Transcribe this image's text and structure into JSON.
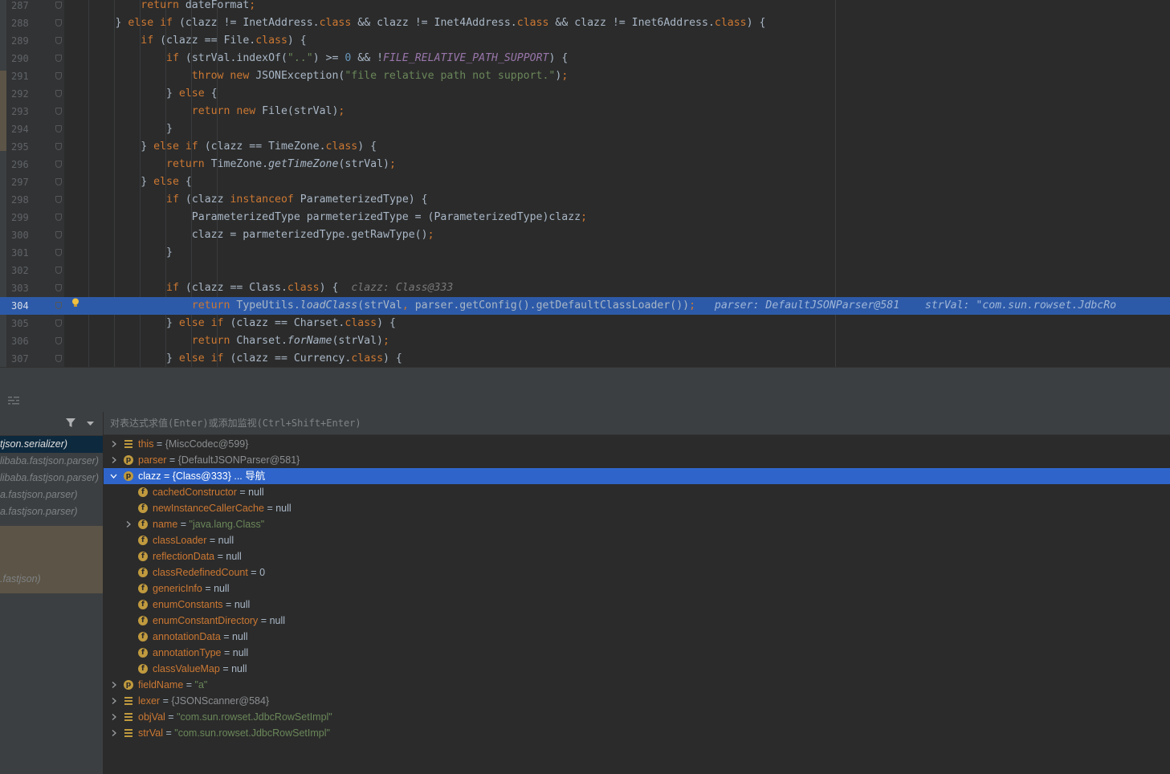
{
  "editor": {
    "lines": [
      {
        "n": "287",
        "code": [
          [
            "",
            "            "
          ],
          [
            "kw",
            "return "
          ],
          [
            "",
            "dateFormat"
          ],
          [
            "kw",
            ";"
          ]
        ]
      },
      {
        "n": "288",
        "code": [
          [
            "",
            "        } "
          ],
          [
            "kw",
            "else if "
          ],
          [
            "",
            "(clazz != InetAddress."
          ],
          [
            "kw",
            "class "
          ],
          [
            "",
            "&& clazz != Inet4Address."
          ],
          [
            "kw",
            "class "
          ],
          [
            "",
            "&& clazz != Inet6Address."
          ],
          [
            "kw",
            "class"
          ],
          [
            "",
            ") {"
          ]
        ]
      },
      {
        "n": "289",
        "code": [
          [
            "",
            "            "
          ],
          [
            "kw",
            "if "
          ],
          [
            "",
            "(clazz == File."
          ],
          [
            "kw",
            "class"
          ],
          [
            "",
            ") {"
          ]
        ]
      },
      {
        "n": "290",
        "code": [
          [
            "",
            "                "
          ],
          [
            "kw",
            "if "
          ],
          [
            "",
            "(strVal.indexOf("
          ],
          [
            "str",
            "\"..\""
          ],
          [
            "",
            ") >= "
          ],
          [
            "num",
            "0 "
          ],
          [
            "",
            "&& !"
          ],
          [
            "cst",
            "FILE_RELATIVE_PATH_SUPPORT"
          ],
          [
            "",
            ") {"
          ]
        ]
      },
      {
        "n": "291",
        "code": [
          [
            "",
            "                    "
          ],
          [
            "kw",
            "throw new "
          ],
          [
            "",
            "JSONException("
          ],
          [
            "str",
            "\"file relative path not support.\""
          ],
          [
            "",
            ")"
          ],
          [
            "kw",
            ";"
          ]
        ]
      },
      {
        "n": "292",
        "code": [
          [
            "",
            "                } "
          ],
          [
            "kw",
            "else "
          ],
          [
            "",
            "{"
          ]
        ]
      },
      {
        "n": "293",
        "code": [
          [
            "",
            "                    "
          ],
          [
            "kw",
            "return new "
          ],
          [
            "",
            "File(strVal)"
          ],
          [
            "kw",
            ";"
          ]
        ]
      },
      {
        "n": "294",
        "code": [
          [
            "",
            "                }"
          ]
        ]
      },
      {
        "n": "295",
        "code": [
          [
            "",
            "            } "
          ],
          [
            "kw",
            "else if "
          ],
          [
            "",
            "(clazz == TimeZone."
          ],
          [
            "kw",
            "class"
          ],
          [
            "",
            ") {"
          ]
        ]
      },
      {
        "n": "296",
        "code": [
          [
            "",
            "                "
          ],
          [
            "kw",
            "return "
          ],
          [
            "",
            "TimeZone."
          ],
          [
            "it",
            "getTimeZone"
          ],
          [
            "",
            "(strVal)"
          ],
          [
            "kw",
            ";"
          ]
        ]
      },
      {
        "n": "297",
        "code": [
          [
            "",
            "            } "
          ],
          [
            "kw",
            "else "
          ],
          [
            "",
            "{"
          ]
        ]
      },
      {
        "n": "298",
        "code": [
          [
            "",
            "                "
          ],
          [
            "kw",
            "if "
          ],
          [
            "",
            "(clazz "
          ],
          [
            "kw",
            "instanceof "
          ],
          [
            "",
            "ParameterizedType) {"
          ]
        ]
      },
      {
        "n": "299",
        "code": [
          [
            "",
            "                    ParameterizedType parmeterizedType = (ParameterizedType)clazz"
          ],
          [
            "kw",
            ";"
          ]
        ]
      },
      {
        "n": "300",
        "code": [
          [
            "",
            "                    clazz = parmeterizedType.getRawType()"
          ],
          [
            "kw",
            ";"
          ]
        ]
      },
      {
        "n": "301",
        "code": [
          [
            "",
            "                }"
          ]
        ]
      },
      {
        "n": "302",
        "code": []
      },
      {
        "n": "303",
        "code": [
          [
            "",
            "                "
          ],
          [
            "kw",
            "if "
          ],
          [
            "",
            "(clazz == Class."
          ],
          [
            "kw",
            "class"
          ],
          [
            "",
            ") {  "
          ],
          [
            "hint",
            "clazz: Class@333"
          ]
        ]
      },
      {
        "n": "304",
        "exec": true,
        "code": [
          [
            "",
            "                    "
          ],
          [
            "kw",
            "return "
          ],
          [
            "",
            "TypeUtils."
          ],
          [
            "it",
            "loadClass"
          ],
          [
            "",
            "(strVal"
          ],
          [
            "kw",
            ", "
          ],
          [
            "",
            "parser.getConfig().getDefaultClassLoader())"
          ],
          [
            "kw",
            ";"
          ],
          [
            "",
            "   "
          ],
          [
            "hint-exec",
            "parser: DefaultJSONParser@581    strVal: \"com.sun.rowset.JdbcRo"
          ]
        ]
      },
      {
        "n": "305",
        "code": [
          [
            "",
            "                } "
          ],
          [
            "kw",
            "else if "
          ],
          [
            "",
            "(clazz == Charset."
          ],
          [
            "kw",
            "class"
          ],
          [
            "",
            ") {"
          ]
        ]
      },
      {
        "n": "306",
        "code": [
          [
            "",
            "                    "
          ],
          [
            "kw",
            "return "
          ],
          [
            "",
            "Charset."
          ],
          [
            "it",
            "forName"
          ],
          [
            "",
            "(strVal)"
          ],
          [
            "kw",
            ";"
          ]
        ]
      },
      {
        "n": "307",
        "code": [
          [
            "",
            "                } "
          ],
          [
            "kw",
            "else if "
          ],
          [
            "",
            "(clazz == Currency."
          ],
          [
            "kw",
            "class"
          ],
          [
            "",
            ") {"
          ]
        ]
      }
    ]
  },
  "frames": [
    {
      "label": "tjson.serializer)",
      "selected": true
    },
    {
      "label": "libaba.fastjson.parser)",
      "selected": false
    },
    {
      "label": "libaba.fastjson.parser)",
      "selected": false
    },
    {
      "label": "a.fastjson.parser)",
      "selected": false
    },
    {
      "label": "a.fastjson.parser)",
      "selected": false
    },
    {
      "label": "",
      "selected": false
    },
    {
      "label": "",
      "selected": false
    },
    {
      "label": "",
      "selected": false
    },
    {
      "label": ".fastjson)",
      "selected": false
    }
  ],
  "eval_placeholder": "对表达式求值(Enter)或添加监视(Ctrl+Shift+Enter)",
  "variables": [
    {
      "depth": 0,
      "arrow": "right",
      "icon": "lines",
      "name": "this",
      "value": "{MiscCodec@599}",
      "kind": "obj"
    },
    {
      "depth": 0,
      "arrow": "right",
      "icon": "p",
      "name": "parser",
      "value": "{DefaultJSONParser@581}",
      "kind": "obj"
    },
    {
      "depth": 0,
      "arrow": "down",
      "icon": "p",
      "name": "clazz",
      "value": "{Class@333}",
      "tail": " ... 导航",
      "kind": "obj",
      "selected": true
    },
    {
      "depth": 1,
      "arrow": "",
      "icon": "f",
      "name": "cachedConstructor",
      "value": "null",
      "kind": "plain"
    },
    {
      "depth": 1,
      "arrow": "",
      "icon": "f",
      "name": "newInstanceCallerCache",
      "value": "null",
      "kind": "plain"
    },
    {
      "depth": 1,
      "arrow": "right",
      "icon": "f",
      "name": "name",
      "value": "\"java.lang.Class\"",
      "kind": "str"
    },
    {
      "depth": 1,
      "arrow": "",
      "icon": "f",
      "name": "classLoader",
      "value": "null",
      "kind": "plain"
    },
    {
      "depth": 1,
      "arrow": "",
      "icon": "f",
      "name": "reflectionData",
      "value": "null",
      "kind": "plain"
    },
    {
      "depth": 1,
      "arrow": "",
      "icon": "f",
      "name": "classRedefinedCount",
      "value": "0",
      "kind": "plain"
    },
    {
      "depth": 1,
      "arrow": "",
      "icon": "f",
      "name": "genericInfo",
      "value": "null",
      "kind": "plain"
    },
    {
      "depth": 1,
      "arrow": "",
      "icon": "f",
      "name": "enumConstants",
      "value": "null",
      "kind": "plain"
    },
    {
      "depth": 1,
      "arrow": "",
      "icon": "f",
      "name": "enumConstantDirectory",
      "value": "null",
      "kind": "plain"
    },
    {
      "depth": 1,
      "arrow": "",
      "icon": "f",
      "name": "annotationData",
      "value": "null",
      "kind": "plain"
    },
    {
      "depth": 1,
      "arrow": "",
      "icon": "f",
      "name": "annotationType",
      "value": "null",
      "kind": "plain"
    },
    {
      "depth": 1,
      "arrow": "",
      "icon": "f",
      "name": "classValueMap",
      "value": "null",
      "kind": "plain"
    },
    {
      "depth": 0,
      "arrow": "right",
      "icon": "p",
      "name": "fieldName",
      "value": "\"a\"",
      "kind": "str"
    },
    {
      "depth": 0,
      "arrow": "right",
      "icon": "lines",
      "name": "lexer",
      "value": "{JSONScanner@584}",
      "kind": "obj"
    },
    {
      "depth": 0,
      "arrow": "right",
      "icon": "lines",
      "name": "objVal",
      "value": "\"com.sun.rowset.JdbcRowSetImpl\"",
      "kind": "str"
    },
    {
      "depth": 0,
      "arrow": "right",
      "icon": "lines",
      "name": "strVal",
      "value": "\"com.sun.rowset.JdbcRowSetImpl\"",
      "kind": "str"
    }
  ],
  "colors": {
    "editor_bg": "#2b2b2b",
    "execution_line": "#2d5aa8",
    "selected_variable": "#2f65ca",
    "keyword": "#cc7832",
    "string": "#6a8759",
    "number": "#6897bb",
    "constant": "#9876aa"
  }
}
